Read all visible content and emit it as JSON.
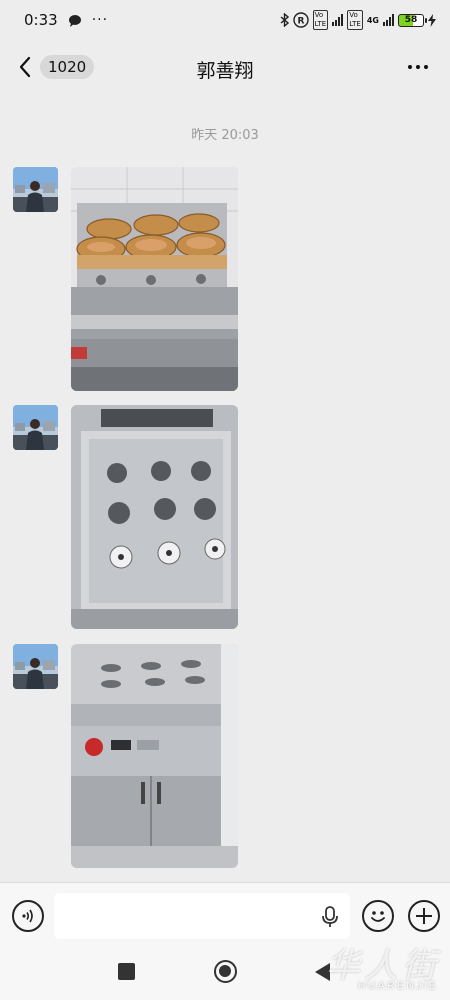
{
  "status_bar": {
    "time": "0:33",
    "battery_level": "58",
    "network": "4G",
    "volte_tag": "Vo LTE"
  },
  "header": {
    "unread_count": "1020",
    "title": "郭善翔"
  },
  "chat": {
    "timestamp": "昨天 20:03",
    "messages": [
      {
        "type": "image",
        "sender": "contact",
        "content": "steamer-with-bamboo-baskets"
      },
      {
        "type": "image",
        "sender": "contact",
        "content": "steamer-top-nine-holes"
      },
      {
        "type": "image",
        "sender": "contact",
        "content": "steamer-cabinet-front"
      }
    ]
  },
  "input_bar": {
    "placeholder": ""
  },
  "watermark": {
    "cn": "华人街",
    "en": "HUARENJIE"
  },
  "colors": {
    "background": "#ededed",
    "battery_fill": "#7ed321",
    "input_bar": "#f7f7f7"
  }
}
